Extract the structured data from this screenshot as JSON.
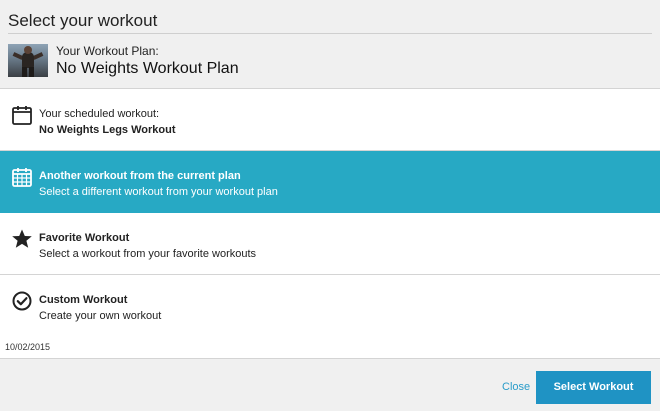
{
  "dialog": {
    "title": "Select your workout",
    "plan": {
      "label": "Your Workout Plan:",
      "name": "No Weights Workout Plan"
    },
    "options": [
      {
        "icon": "calendar-icon",
        "line1": "Your scheduled workout:",
        "line2": "No Weights Legs Workout",
        "selected": false
      },
      {
        "icon": "calendar-grid-icon",
        "line1": "Another workout from the current plan",
        "line2": "Select a different workout from your workout plan",
        "selected": true
      },
      {
        "icon": "star-icon",
        "line1": "Favorite Workout",
        "line2": "Select a workout from your favorite workouts",
        "selected": false
      },
      {
        "icon": "check-circle-icon",
        "line1": "Custom Workout",
        "line2": "Create your own workout",
        "selected": false
      }
    ],
    "date": "10/02/2015",
    "close_label": "Close",
    "select_label": "Select Workout"
  },
  "colors": {
    "selected_bg": "#27a9c4",
    "button_bg": "#1f93c4",
    "link": "#2a9cc9",
    "page_bg": "#f0f0f0"
  }
}
